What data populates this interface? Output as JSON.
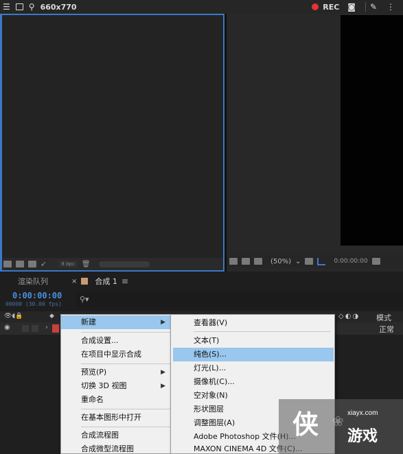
{
  "topbar": {
    "title": "660x770",
    "rec_label": "REC"
  },
  "project_panel": {
    "bpc_label": "8 bpc"
  },
  "viewer": {
    "zoom_label": "(50%)",
    "timecode": "0:00:00:00"
  },
  "timeline": {
    "tab_render": "渲染队列",
    "tab_close": "×",
    "tab_comp": "合成 1",
    "timecode": "0:00:00:00",
    "fps": "00000 (30.00 fps)",
    "mode_header": "模式",
    "mode_value": "正常"
  },
  "context_menu": {
    "items": [
      {
        "label": "新建",
        "has_submenu": true,
        "highlighted": true
      },
      {
        "label": "合成设置..."
      },
      {
        "label": "在项目中显示合成"
      },
      {
        "label": "预览(P)",
        "has_submenu": true
      },
      {
        "label": "切换 3D 视图",
        "has_submenu": true
      },
      {
        "label": "重命名"
      },
      {
        "label": "在基本图形中打开"
      },
      {
        "label": "合成流程图"
      },
      {
        "label": "合成微型流程图"
      }
    ]
  },
  "submenu": {
    "items": [
      {
        "label": "查看器(V)"
      },
      {
        "label": "文本(T)"
      },
      {
        "label": "纯色(S)...",
        "highlighted": true
      },
      {
        "label": "灯光(L)..."
      },
      {
        "label": "摄像机(C)..."
      },
      {
        "label": "空对象(N)"
      },
      {
        "label": "形状图层"
      },
      {
        "label": "调整图层(A)"
      },
      {
        "label": "Adobe Photoshop 文件(H)..."
      },
      {
        "label": "MAXON CINEMA 4D 文件(C)..."
      }
    ]
  },
  "watermark": {
    "logo_char": "侠",
    "url": "xiayx.com",
    "name": "游戏"
  },
  "colors": {
    "accent_blue": "#3c79c8",
    "timecode_blue": "#4a8fe0",
    "menu_highlight": "#99c7ee",
    "rec_red": "#e53232"
  }
}
